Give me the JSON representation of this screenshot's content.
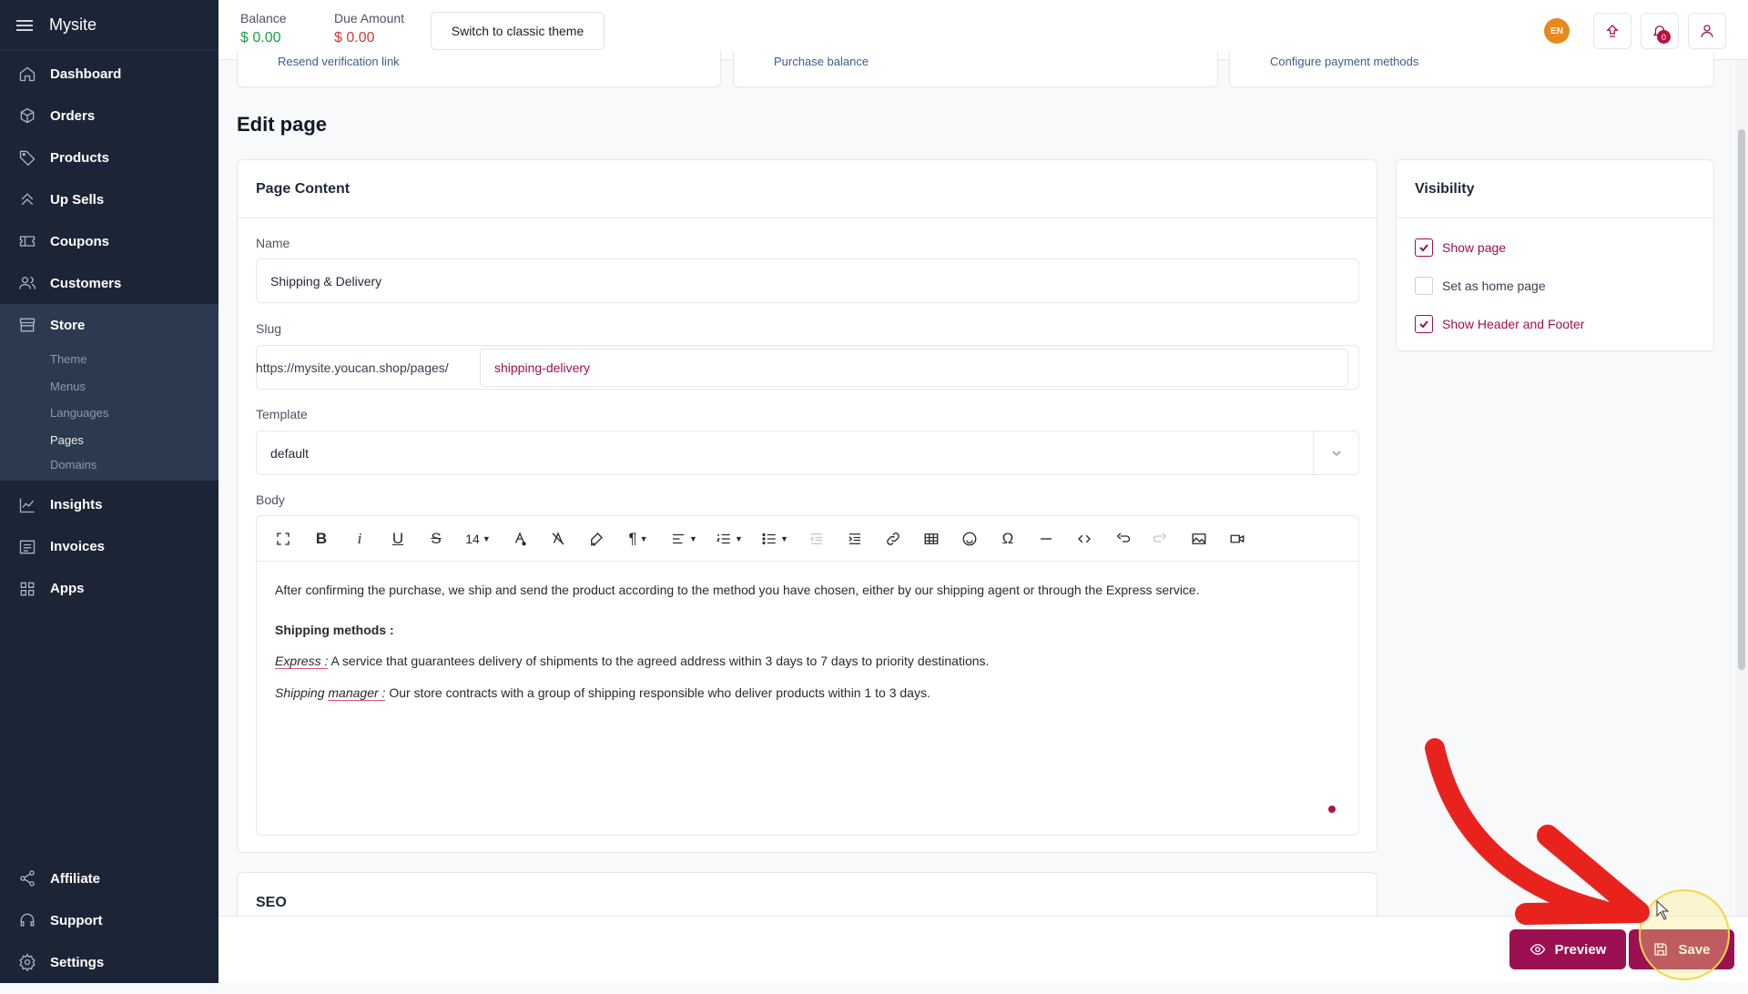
{
  "sidebar": {
    "brand": "Mysite",
    "items": [
      {
        "label": "Dashboard",
        "icon": "home-icon"
      },
      {
        "label": "Orders",
        "icon": "box-icon"
      },
      {
        "label": "Products",
        "icon": "tag-icon"
      },
      {
        "label": "Up Sells",
        "icon": "chevrons-up-icon"
      },
      {
        "label": "Coupons",
        "icon": "ticket-icon"
      },
      {
        "label": "Customers",
        "icon": "users-icon"
      }
    ],
    "store": {
      "label": "Store",
      "icon": "store-icon",
      "sub_items": [
        "Theme",
        "Menus",
        "Languages",
        "Pages",
        "Domains"
      ]
    },
    "items_after": [
      {
        "label": "Insights",
        "icon": "chart-icon"
      },
      {
        "label": "Invoices",
        "icon": "invoice-icon"
      },
      {
        "label": "Apps",
        "icon": "apps-icon"
      }
    ],
    "bottom": [
      {
        "label": "Affiliate",
        "icon": "share-icon"
      },
      {
        "label": "Support",
        "icon": "headset-icon"
      },
      {
        "label": "Settings",
        "icon": "gear-icon"
      }
    ]
  },
  "topbar": {
    "balance_label": "Balance",
    "balance_value": "$ 0.00",
    "due_label": "Due Amount",
    "due_value": "$ 0.00",
    "switch_label": "Switch to classic theme",
    "lang": "EN",
    "notif_count": "0"
  },
  "alerts": [
    "Resend verification link",
    "Purchase balance",
    "Configure payment methods"
  ],
  "page": {
    "title": "Edit page",
    "content_card_title": "Page Content",
    "name_label": "Name",
    "name_value": "Shipping & Delivery",
    "slug_label": "Slug",
    "slug_prefix": "https://mysite.youcan.shop/pages/",
    "slug_value": "shipping-delivery",
    "template_label": "Template",
    "template_value": "default",
    "body_label": "Body",
    "font_size": "14",
    "body": {
      "p1": "After confirming the purchase, we ship and send the product according to the method you have chosen, either by our shipping agent or through the Express service.",
      "heading": "Shipping methods :",
      "express_term": "Express :",
      "express_text": " A service that guarantees delivery of shipments to the agreed address within 3 days to 7 days to priority destinations.",
      "manager_term_a": "Shipping ",
      "manager_term_b": "manager :",
      "manager_text": " Our store contracts with a group of shipping responsible who deliver products within 1 to 3 days."
    },
    "seo_title": "SEO"
  },
  "visibility": {
    "title": "Visibility",
    "options": [
      {
        "label": "Show page",
        "checked": true
      },
      {
        "label": "Set as home page",
        "checked": false
      },
      {
        "label": "Show Header and Footer",
        "checked": true
      }
    ]
  },
  "actions": {
    "preview_label": "Preview",
    "save_label": "Save"
  },
  "colors": {
    "brand": "#9b1050",
    "sidebar_bg": "#1c2536",
    "balance_green": "#1a9c4a",
    "due_red": "#d23a3a",
    "annotation_arrow": "#e8231e"
  }
}
